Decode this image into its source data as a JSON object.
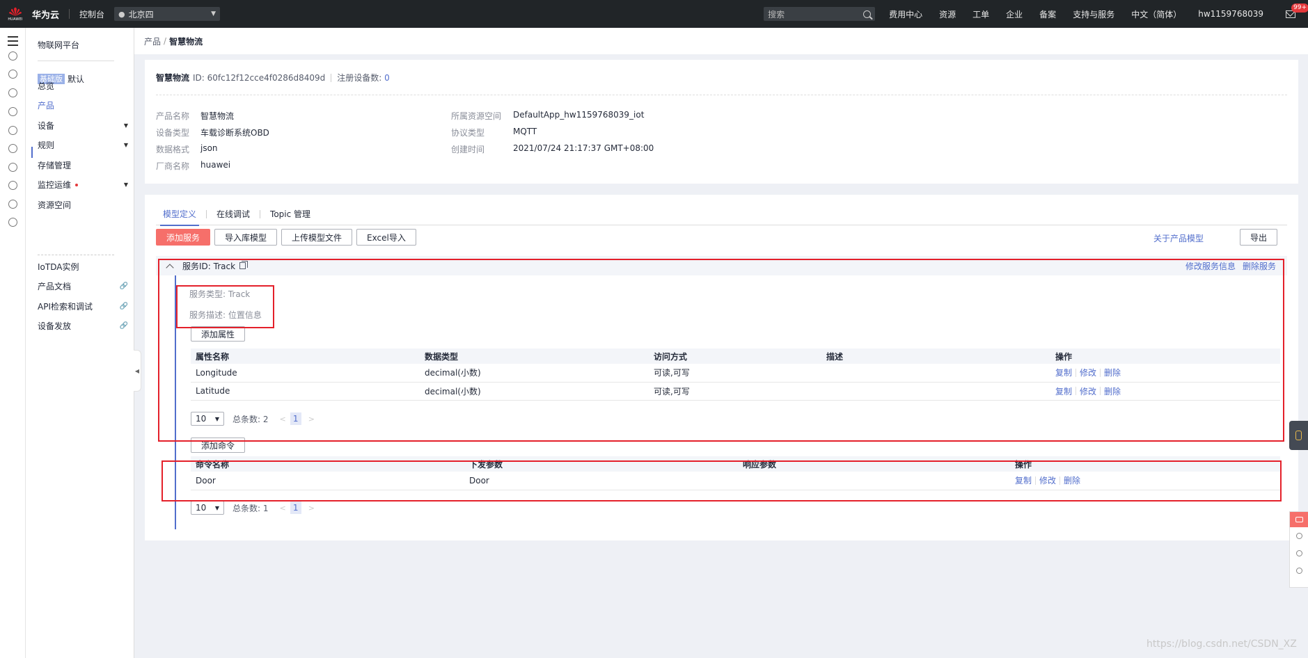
{
  "topbar": {
    "logo_small": "HUAWEI",
    "brand": "华为云",
    "console": "控制台",
    "region": "北京四",
    "search_placeholder": "搜索",
    "links": [
      "费用中心",
      "资源",
      "工单",
      "企业",
      "备案",
      "支持与服务",
      "中文（简体）",
      "hw1159768039"
    ],
    "mail_badge": "99+"
  },
  "sidebar": {
    "title": "物联网平台",
    "edition_tag": "基础版",
    "edition_label": "默认",
    "items": [
      {
        "label": "总览"
      },
      {
        "label": "产品"
      },
      {
        "label": "设备"
      },
      {
        "label": "规则"
      },
      {
        "label": "存储管理"
      },
      {
        "label": "监控运维"
      },
      {
        "label": "资源空间"
      },
      {
        "label": "IoTDA实例"
      },
      {
        "label": "产品文档"
      },
      {
        "label": "API检索和调试"
      },
      {
        "label": "设备发放"
      }
    ]
  },
  "breadcrumb": {
    "parent": "产品",
    "separator": "/",
    "current": "智慧物流"
  },
  "product": {
    "name": "智慧物流",
    "id_text": "ID: 60fc12f12cce4f0286d8409d",
    "count_label": "注册设备数:",
    "count_value": "0",
    "fields_left": [
      {
        "k": "产品名称",
        "v": "智慧物流"
      },
      {
        "k": "设备类型",
        "v": "车载诊断系统OBD"
      },
      {
        "k": "数据格式",
        "v": "json"
      },
      {
        "k": "厂商名称",
        "v": "huawei"
      }
    ],
    "fields_right": [
      {
        "k": "所属资源空间",
        "v": "DefaultApp_hw1159768039_iot"
      },
      {
        "k": "协议类型",
        "v": "MQTT"
      },
      {
        "k": "创建时间",
        "v": "2021/07/24 21:17:37 GMT+08:00"
      }
    ]
  },
  "tabs": [
    "模型定义",
    "在线调试",
    "Topic 管理"
  ],
  "buttons": {
    "add_service": "添加服务",
    "import_lib": "导入库模型",
    "upload_model": "上传模型文件",
    "excel_import": "Excel导入",
    "about_model": "关于产品模型",
    "export": "导出"
  },
  "service": {
    "id_text": "服务ID: Track",
    "edit": "修改服务信息",
    "delete": "删除服务",
    "type_text": "服务类型: Track",
    "desc_text": "服务描述: 位置信息",
    "add_property": "添加属性",
    "prop_headers": [
      "属性名称",
      "数据类型",
      "访问方式",
      "描述",
      "操作"
    ],
    "properties": [
      {
        "name": "Longitude",
        "type": "decimal(小数)",
        "access": "可读,可写",
        "desc": ""
      },
      {
        "name": "Latitude",
        "type": "decimal(小数)",
        "access": "可读,可写",
        "desc": ""
      }
    ],
    "ops": [
      "复制",
      "修改",
      "删除"
    ],
    "prop_pager": {
      "size": "10",
      "total": "总条数: 2",
      "page": "1"
    },
    "add_command": "添加命令",
    "cmd_headers": [
      "命令名称",
      "下发参数",
      "响应参数",
      "操作"
    ],
    "commands": [
      {
        "name": "Door",
        "params": "Door",
        "resp": ""
      }
    ],
    "cmd_pager": {
      "size": "10",
      "total": "总条数: 1",
      "page": "1"
    }
  },
  "watermark": "https://blog.csdn.net/CSDN_XZ",
  "colors": {
    "accent": "#526ecc",
    "primary_button": "#f66f6a",
    "highlight_box": "#e4202a",
    "topbar": "#212528"
  }
}
